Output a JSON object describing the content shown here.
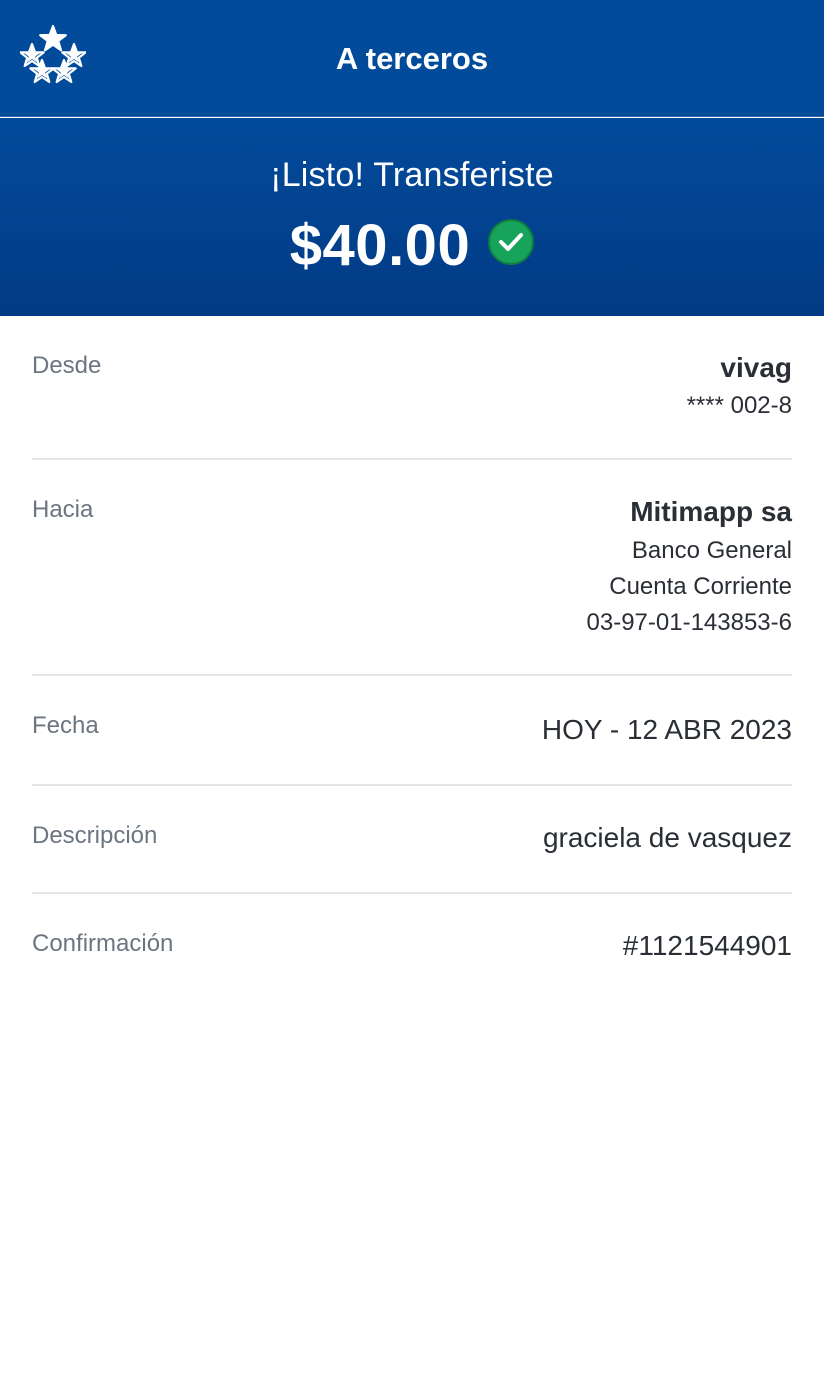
{
  "header": {
    "title": "A terceros",
    "logo_icon": "five-stars-logo-icon"
  },
  "hero": {
    "title": "¡Listo! Transferiste",
    "amount": "$40.00",
    "status_icon": "check-circle-icon"
  },
  "details": {
    "desde": {
      "label": "Desde",
      "name": "vivag",
      "account": "**** 002-8"
    },
    "hacia": {
      "label": "Hacia",
      "name": "Mitimapp sa",
      "bank": "Banco General",
      "account_type": "Cuenta Corriente",
      "account_number": "03-97-01-143853-6"
    },
    "fecha": {
      "label": "Fecha",
      "value": "HOY - 12 ABR 2023"
    },
    "descripcion": {
      "label": "Descripción",
      "value": "graciela de vasquez"
    },
    "confirmacion": {
      "label": "Confirmación",
      "value": "#1121544901"
    }
  },
  "colors": {
    "header_blue": "#014b9a",
    "hero_gradient_top": "#024b9b",
    "hero_gradient_bottom": "#023a85",
    "success_green": "#17a35a",
    "label_gray": "#6c7580",
    "value_dark": "#2a2f36",
    "divider": "#e3e5e8"
  }
}
